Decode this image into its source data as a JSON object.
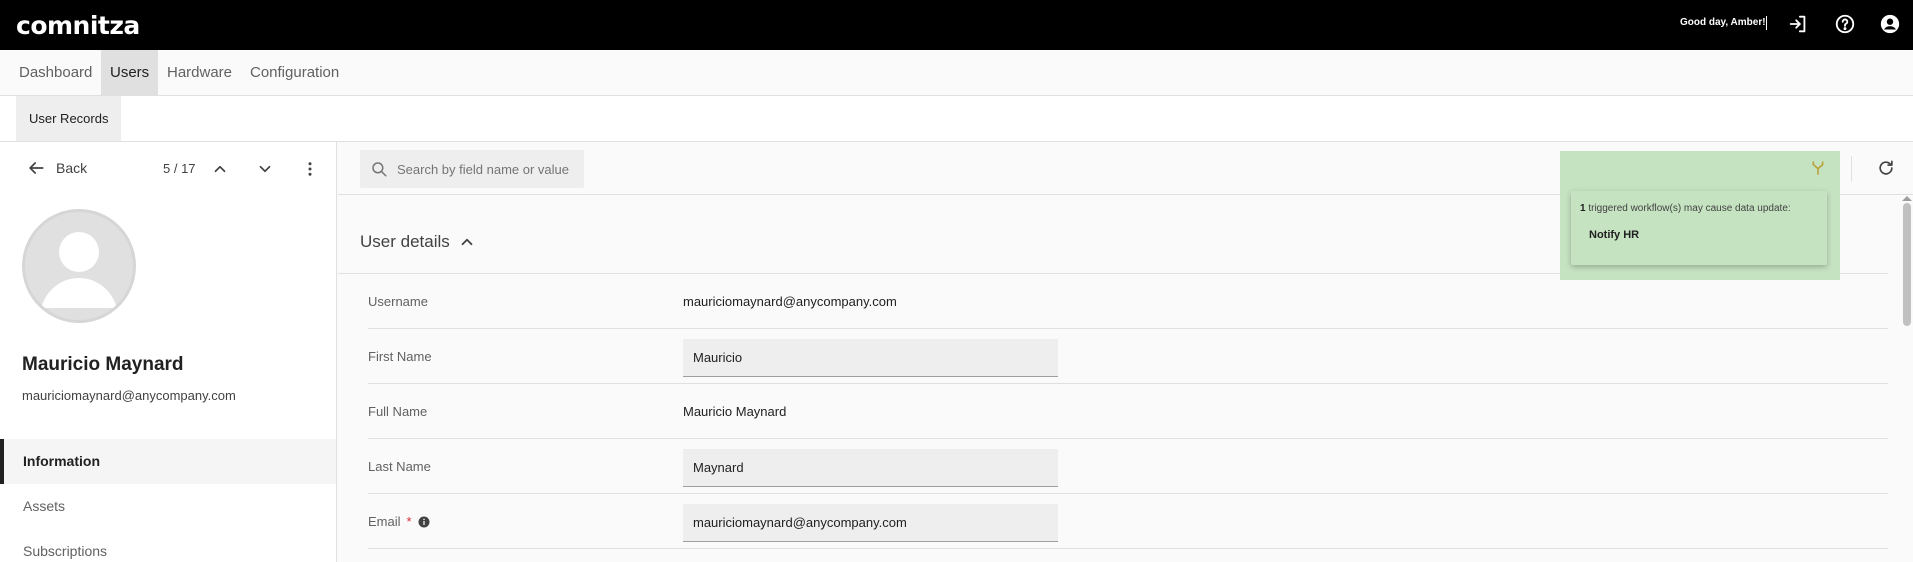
{
  "app": {
    "logo": "comnitza",
    "greeting": "Good day, Amber!"
  },
  "nav": {
    "tabs": [
      "Dashboard",
      "Users",
      "Hardware",
      "Configuration"
    ],
    "active": "Users"
  },
  "subnav": {
    "tab": "User Records"
  },
  "record_nav": {
    "back_label": "Back",
    "pager": "5 / 17"
  },
  "user": {
    "name": "Mauricio Maynard",
    "email": "mauriciomaynard@anycompany.com"
  },
  "side_menu": {
    "items": [
      "Information",
      "Assets",
      "Subscriptions"
    ],
    "active": "Information"
  },
  "search": {
    "placeholder": "Search by field name or value"
  },
  "section": {
    "title": "User details"
  },
  "fields": {
    "username": {
      "label": "Username",
      "value": "mauriciomaynard@anycompany.com"
    },
    "first_name": {
      "label": "First Name",
      "value": "Mauricio"
    },
    "full_name": {
      "label": "Full Name",
      "value": "Mauricio Maynard"
    },
    "last_name": {
      "label": "Last Name",
      "value": "Maynard"
    },
    "email": {
      "label": "Email",
      "required_mark": "*",
      "value": "mauriciomaynard@anycompany.com"
    }
  },
  "workflow": {
    "count": "1",
    "message": "triggered workflow(s) may cause data update:",
    "name": "Notify HR"
  },
  "colors": {
    "topbar": "#000000",
    "highlight": "#c5e3c1",
    "workflow_icon": "#b8a23a",
    "required": "#d32f2f"
  },
  "icons": {
    "logout": "logout-icon",
    "help": "help-icon",
    "account": "account-circle-icon",
    "back": "arrow-left-icon",
    "prev": "chevron-up-icon",
    "next": "chevron-down-icon",
    "more": "more-vertical-icon",
    "search": "search-icon",
    "workflow": "workflow-icon",
    "refresh": "refresh-icon",
    "info": "info-icon"
  }
}
